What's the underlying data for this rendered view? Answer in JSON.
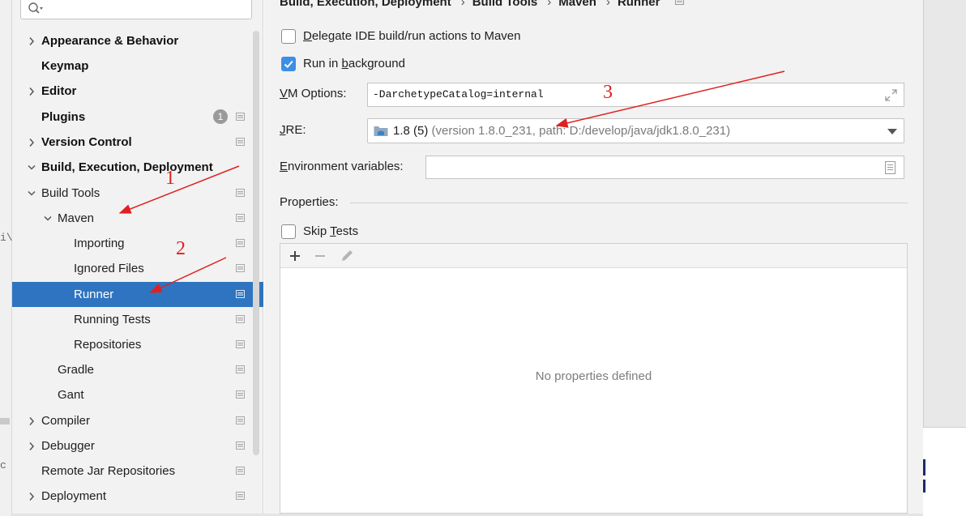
{
  "backdrop": {
    "left_fragment_1": "i\\c",
    "left_fragment_2": "c 2"
  },
  "sidebar": {
    "search": {
      "placeholder": "",
      "value": ""
    },
    "items": [
      {
        "label": "Appearance & Behavior",
        "level": 0,
        "bold": true,
        "expandable": true,
        "expanded": false
      },
      {
        "label": "Keymap",
        "level": 0,
        "bold": true,
        "expandable": false
      },
      {
        "label": "Editor",
        "level": 0,
        "bold": true,
        "expandable": true,
        "expanded": false
      },
      {
        "label": "Plugins",
        "level": 0,
        "bold": true,
        "expandable": false,
        "badge": "1"
      },
      {
        "label": "Version Control",
        "level": 0,
        "bold": true,
        "expandable": true,
        "expanded": false
      },
      {
        "label": "Build, Execution, Deployment",
        "level": 0,
        "bold": true,
        "expandable": true,
        "expanded": true
      },
      {
        "label": "Build Tools",
        "level": 1,
        "expandable": true,
        "expanded": true
      },
      {
        "label": "Maven",
        "level": 2,
        "expandable": true,
        "expanded": true
      },
      {
        "label": "Importing",
        "level": 3
      },
      {
        "label": "Ignored Files",
        "level": 3
      },
      {
        "label": "Runner",
        "level": 3,
        "selected": true
      },
      {
        "label": "Running Tests",
        "level": 3
      },
      {
        "label": "Repositories",
        "level": 3
      },
      {
        "label": "Gradle",
        "level": 2
      },
      {
        "label": "Gant",
        "level": 2
      },
      {
        "label": "Compiler",
        "level": 1,
        "expandable": true,
        "expanded": false
      },
      {
        "label": "Debugger",
        "level": 1,
        "expandable": true,
        "expanded": false
      },
      {
        "label": "Remote Jar Repositories",
        "level": 1
      },
      {
        "label": "Deployment",
        "level": 1,
        "expandable": true,
        "expanded": false
      }
    ]
  },
  "breadcrumb": [
    "Build, Execution, Deployment",
    "Build Tools",
    "Maven",
    "Runner"
  ],
  "runner": {
    "delegate": {
      "pre": "",
      "mnemonic": "D",
      "post": "elegate IDE build/run actions to Maven",
      "checked": false
    },
    "background": {
      "pre": "Run in ",
      "mnemonic": "b",
      "post": "ackground",
      "checked": true
    },
    "vm_options": {
      "label_mnemonic": "V",
      "label_rest": "M Options:",
      "value": "-DarchetypeCatalog=internal"
    },
    "jre": {
      "label_mnemonic": "J",
      "label_rest": "RE:",
      "version": "1.8 (5)",
      "detail": "(version 1.8.0_231, path: D:/develop/java/jdk1.8.0_231)"
    },
    "env": {
      "label_mnemonic": "E",
      "label_rest": "nvironment variables:",
      "value": ""
    },
    "properties": {
      "title": "Properties:",
      "skip_tests": {
        "pre": "Skip ",
        "mnemonic": "T",
        "post": "ests",
        "checked": false
      },
      "empty_text": "No properties defined"
    }
  },
  "annotations": {
    "color": "#e02020",
    "labels": [
      "1",
      "2",
      "3"
    ]
  },
  "colors": {
    "selection": "#2f74c0",
    "checkbox_on": "#3d8ee6",
    "panel": "#f2f2f2"
  }
}
